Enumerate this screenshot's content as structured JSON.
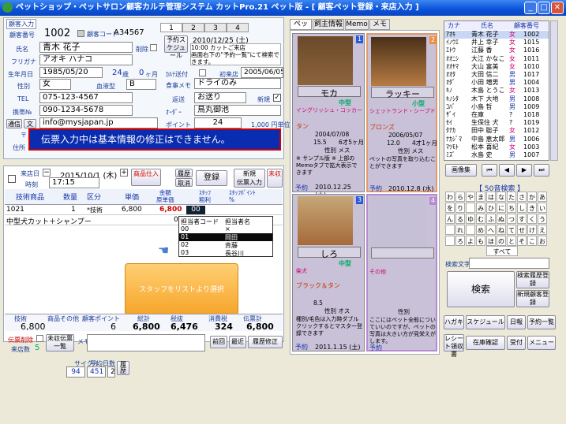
{
  "window": {
    "title": "ペットショップ・ペットサロン顧客カルテ管理システム カットPro.21 ペット版 - [ 顧客ペット登録・来店入力 ]",
    "min": "_",
    "max": "□",
    "close": "✕"
  },
  "customer": {
    "section": "顧客入力",
    "id_label": "顧客番号",
    "id": "1002",
    "register_label": "顧客コード",
    "register": "A34567",
    "delete_label": "削除",
    "name_label": "氏名",
    "name": "青木 花子",
    "kana_label": "フリガナ",
    "kana": "アオキ ハナコ",
    "birth_label": "生年月日",
    "birth": "1985/05/20",
    "age": "24",
    "age_unit": "歳",
    "month": "0",
    "month_unit": "ヶ月",
    "gender_label": "性別",
    "gender": "女",
    "blood_label": "血液型",
    "blood": "B",
    "tel_label": "TEL",
    "tel": "075-123-4567",
    "mobile_label": "携帯№",
    "mobile": "090-1234-5678",
    "mail_label1": "通信",
    "mail_label2": "文",
    "email": "info@mysjapan.jp",
    "dm_label": "住所",
    "zip_label": "〒"
  },
  "visit_panel": {
    "tabs": [
      "1",
      "2",
      "3",
      "4"
    ],
    "schedule_label": "予約スケジュール",
    "date": "2010/12/25 (土)",
    "note": "10:00 カットご来店\n画面右下の\"予約一覧\"にて検索できます。",
    "caution_label": "ｶﾙﾃ送付",
    "first_label": "初来店",
    "first": "2005/06/05",
    "food_label": "食事メモ",
    "food": "ドライのみ",
    "return_label": "返送",
    "return": "お送り",
    "new_label": "新規",
    "hair_label": "ｵｰﾀﾞｰ",
    "hair": "鳥丸御池",
    "point_label": "ポイント",
    "point": "24",
    "point_value": "1,000 円単位"
  },
  "warning": "伝票入力中は基本情報の修正はできません。",
  "slip": {
    "date_label": "来店日",
    "time_label": "時刻",
    "date": "2015/10/1 (木)",
    "time": "17:15",
    "product_btn": "商品仕入",
    "history_btn": "履歴",
    "cancel_btn": "取消",
    "register_btn": "登録",
    "new_btn": "新規\n伝票入力",
    "unsent_btn": "未収"
  },
  "table": {
    "headers": [
      "技術商品",
      "数量",
      "区分",
      "単価",
      "金額\n原単価",
      "ｽﾀｯﾌ\n粗利",
      "ｽﾀｯﾌﾎﾟｲﾝﾄ\n%"
    ],
    "rows": [
      {
        "code": "1021",
        "qty": "1",
        "cat": "*技術",
        "price": "6,800",
        "amount": "6,800",
        "staff": "00"
      },
      {
        "name": "中型犬カット＋シャンプー",
        "qty": "",
        "cat": "",
        "price": "",
        "amount": "0",
        "staff": ""
      }
    ]
  },
  "staff_dropdown": {
    "header_code": "担当者コード",
    "header_name": "担当者名",
    "items": [
      {
        "code": "00",
        "name": "×"
      },
      {
        "code": "01",
        "name": "岡田"
      },
      {
        "code": "02",
        "name": "斉藤"
      },
      {
        "code": "03",
        "name": "長谷川"
      }
    ]
  },
  "callout": "スタッフをリストより選択",
  "totals": {
    "labels": [
      "技術",
      "商品その他",
      "顧客ポイント",
      "総計",
      "税抜",
      "消費税",
      "伝票計"
    ],
    "values": [
      "6,800",
      "",
      "6",
      "6,800",
      "6,476",
      "324",
      "6,800"
    ]
  },
  "bottom": {
    "delete_label": "伝票削除",
    "count_label": "来店数",
    "count": "5",
    "list_btn": "未収伝票一覧",
    "memo_label": "メモ",
    "prev": "前回",
    "recent": "最近",
    "history_fix": "履歴修正",
    "cycle_label": "サイクル",
    "cycle": "94",
    "avg_label": "平均日数",
    "avg": "451",
    "flag": "2",
    "history2": "履歴"
  },
  "pet_tabs": [
    "ペット",
    "飼主情報",
    "Memo",
    "メモ"
  ],
  "pets": [
    {
      "name": "モカ",
      "size": "中型",
      "breed": "イングリッシュ・コッカー・スパニエル",
      "color": "タン",
      "birth": "2004/07/08",
      "age": "6才5ヶ月",
      "weight": "15.5",
      "memo": "性別 メス",
      "note": "※ サンプル版 ※ 上部のMemoタブで拡大表示できます",
      "reserve": "予約",
      "rdate": "2010.12.25 (土)",
      "num": "1"
    },
    {
      "name": "ラッキー",
      "size": "小型",
      "breed": "シェットランド・シープドッグ",
      "color": "ブロンズ",
      "birth": "2006/05/07",
      "age": "4才1ヶ月",
      "weight": "12.0",
      "memo": "性別 メス",
      "note": "ペットの写真を取り込むことができます",
      "reserve": "予約",
      "rdate": "2010.12.8 (水)",
      "num": "2"
    },
    {
      "name": "しろ",
      "size": "中型",
      "breed": "柴犬",
      "color": "ブラック＆タン",
      "birth": "",
      "age": "",
      "weight": "8.5",
      "memo": "性別 オス",
      "note": "種別/毛色は入力時ダブルクリックするとマスター登録できます",
      "reserve": "予約",
      "rdate": "2011.1.15 (土)",
      "num": "3"
    },
    {
      "name": "",
      "size": "",
      "breed": "その他",
      "color": "",
      "birth": "",
      "age": "",
      "weight": "",
      "memo": "性別",
      "note": "ここにはペット全般についていいのですが、ペットの写真は大きい方が見栄えがします。",
      "reserve": "予約",
      "rdate": "",
      "num": "4"
    }
  ],
  "cust_list": {
    "headers": [
      "カナ",
      "氏名",
      "顧客番号"
    ],
    "rows": [
      [
        "ｱｵｷ",
        "青木 花子",
        "女",
        "1002"
      ],
      [
        "ｲﾉｳｴ",
        "井上 幸子",
        "女",
        "1015"
      ],
      [
        "ｴﾄｳ",
        "江藤 香",
        "女",
        "1016"
      ],
      [
        "ｵｵﾆｼ",
        "大江 かなこ",
        "女",
        "1011"
      ],
      [
        "ｵｵﾔﾏ",
        "大山 富美",
        "女",
        "1010"
      ],
      [
        "ｵｵﾀ",
        "大田 信二",
        "男",
        "1017"
      ],
      [
        "ｵﾀﾞ",
        "小田 増男",
        "男",
        "1004"
      ],
      [
        "ｷﾉ",
        "木島 とうこ",
        "女",
        "1013"
      ],
      [
        "ｷﾉｼﾀ",
        "木下 大地",
        "男",
        "1008"
      ],
      [
        "ｺﾊﾞ",
        "小島 哲",
        "男",
        "1009"
      ],
      [
        "ｻﾞｲ",
        "在庫",
        "?",
        "1018"
      ],
      [
        "ｾｲ",
        "生保住 犬",
        "?",
        "1019"
      ],
      [
        "ﾀﾅｶ",
        "田中 聡子",
        "女",
        "1012"
      ],
      [
        "ﾅｶｼﾞﾏ",
        "中島 恵太郎",
        "男",
        "1006"
      ],
      [
        "ﾏﾂﾓﾄ",
        "松本 喜紀",
        "女",
        "1003"
      ],
      [
        "ﾐｽﾞ",
        "水島 史",
        "男",
        "1007"
      ]
    ]
  },
  "nav": {
    "image_btn": "画像集",
    "first": "⏮",
    "prev": "◀",
    "next": "▶",
    "last": "⏭"
  },
  "kana_search": {
    "title": "【 50音検索 】",
    "keys": [
      "わ",
      "ら",
      "や",
      "ま",
      "は",
      "な",
      "た",
      "さ",
      "か",
      "あ",
      "を",
      "り",
      "",
      "み",
      "ひ",
      "に",
      "ち",
      "し",
      "き",
      "い",
      "ん",
      "る",
      "ゆ",
      "む",
      "ふ",
      "ぬ",
      "つ",
      "す",
      "く",
      "う",
      "",
      "れ",
      "",
      "め",
      "へ",
      "ね",
      "て",
      "せ",
      "け",
      "え",
      "",
      "ろ",
      "よ",
      "も",
      "ほ",
      "の",
      "と",
      "そ",
      "こ",
      "お"
    ],
    "all": "すべて",
    "text_label": "検索文字",
    "search_btn": "検索",
    "search_btn2": "検索履歴登録",
    "new_btn": "新規顧客登録"
  },
  "footer_btns": [
    "ハガキ",
    "スケジュール",
    "日報",
    "予約一覧",
    "レシート領収書",
    "在庫確認",
    "受付",
    "メニュー"
  ]
}
